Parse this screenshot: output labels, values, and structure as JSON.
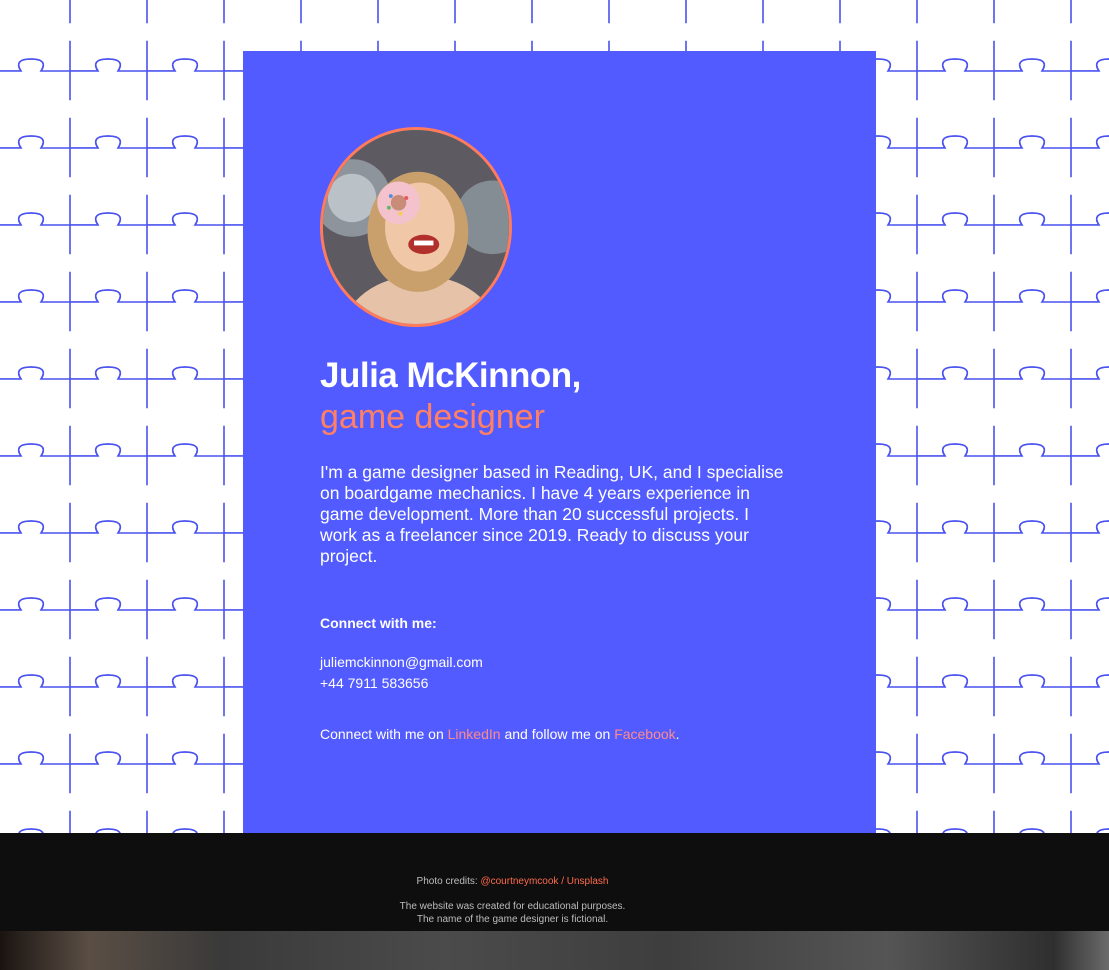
{
  "profile": {
    "name": "Julia McKinnon,",
    "role": "game designer",
    "bio": "I'm a game designer based in Reading, UK, and I specialise on boardgame mechanics. I have 4 years experience in game development. More than 20 successful projects. I work as a freelancer since 2019. Ready to discuss your project."
  },
  "contact": {
    "heading": "Connect with me:",
    "email": "juliemckinnon@gmail.com",
    "phone": "+44 7911 583656"
  },
  "social": {
    "prefix": "Connect with me on ",
    "linkedin_label": "LinkedIn",
    "middle": " and follow me on ",
    "facebook_label": "Facebook",
    "suffix": "."
  },
  "footer": {
    "credits_prefix": "Photo credits: ",
    "credits_link": "@courtneymcook / Unsplash",
    "edu_line1": "The website was created for educational purposes.",
    "edu_line2": "The name of the game designer is fictional."
  },
  "colors": {
    "card": "#525bff",
    "accent": "#ff8064",
    "puzzle_lines": "#4a52ef",
    "footer": "#0e0e0e"
  }
}
